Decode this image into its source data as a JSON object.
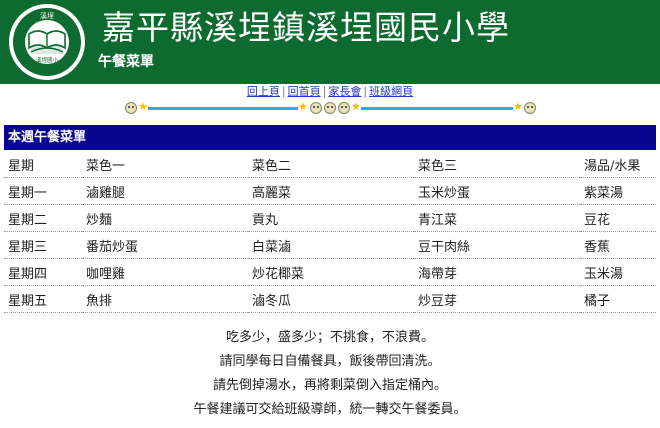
{
  "header": {
    "school_name": "嘉平縣溪埕鎮溪埕國民小學",
    "page_subtitle": "午餐菜單",
    "logo": {
      "top_text": "溪埕",
      "bottom_text": "溪埕國小",
      "icon": "open-book-icon",
      "colors": {
        "ring": "#0d6b2f",
        "inner": "#ffffff"
      }
    }
  },
  "nav": {
    "links": [
      "回上頁",
      "回首頁",
      "家長會",
      "班級網頁"
    ],
    "separator": "|"
  },
  "menu": {
    "heading": "本週午餐菜單",
    "columns": [
      "星期",
      "菜色一",
      "菜色二",
      "菜色三",
      "湯品/水果"
    ],
    "rows": [
      [
        "星期一",
        "滷雞腿",
        "高麗菜",
        "玉米炒蛋",
        "紫菜湯"
      ],
      [
        "星期二",
        "炒麵",
        "貢丸",
        "青江菜",
        "豆花"
      ],
      [
        "星期三",
        "番茄炒蛋",
        "白菜滷",
        "豆干肉絲",
        "香蕉"
      ],
      [
        "星期四",
        "咖哩雞",
        "炒花椰菜",
        "海帶芽",
        "玉米湯"
      ],
      [
        "星期五",
        "魚排",
        "滷冬瓜",
        "炒豆芽",
        "橘子"
      ]
    ]
  },
  "notes": [
    "吃多少，盛多少；不挑食，不浪費。",
    "請同學每日自備餐具，飯後帶回清洗。",
    "請先倒掉湯水，再將剩菜倒入指定桶內。",
    "午餐建議可交給班級導師，統一轉交午餐委員。"
  ],
  "colors": {
    "header_green": "#0d6b2f",
    "menu_heading_bg": "#08068e",
    "link": "#2a36c8",
    "divider_bar": "#27aee8",
    "star": "#e9c400"
  }
}
